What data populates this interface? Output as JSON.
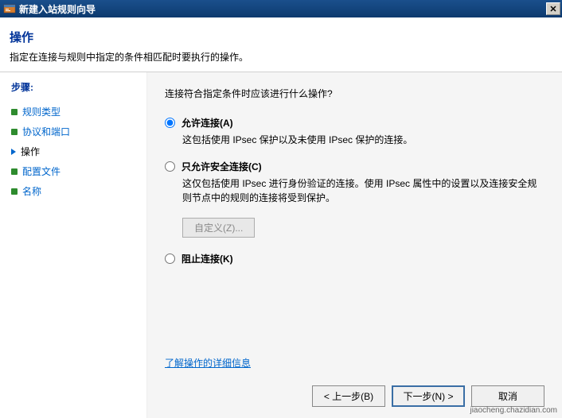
{
  "window": {
    "title": "新建入站规则向导"
  },
  "header": {
    "title": "操作",
    "desc": "指定在连接与规则中指定的条件相匹配时要执行的操作。"
  },
  "sidebar": {
    "steps_label": "步骤:",
    "items": [
      {
        "label": "规则类型",
        "state": "done"
      },
      {
        "label": "协议和端口",
        "state": "done"
      },
      {
        "label": "操作",
        "state": "active"
      },
      {
        "label": "配置文件",
        "state": "pending"
      },
      {
        "label": "名称",
        "state": "pending"
      }
    ]
  },
  "content": {
    "prompt": "连接符合指定条件时应该进行什么操作?",
    "options": {
      "allow": {
        "label": "允许连接(A)",
        "desc": "这包括使用 IPsec 保护以及未使用 IPsec 保护的连接。"
      },
      "allow_secure": {
        "label": "只允许安全连接(C)",
        "desc": "这仅包括使用 IPsec 进行身份验证的连接。使用 IPsec 属性中的设置以及连接安全规则节点中的规则的连接将受到保护。"
      },
      "block": {
        "label": "阻止连接(K)"
      }
    },
    "custom_button": "自定义(Z)...",
    "learn_more": "了解操作的详细信息"
  },
  "buttons": {
    "back": "< 上一步(B)",
    "next": "下一步(N) >",
    "cancel": "取消"
  },
  "watermark": "jiaocheng.chazidian.com"
}
